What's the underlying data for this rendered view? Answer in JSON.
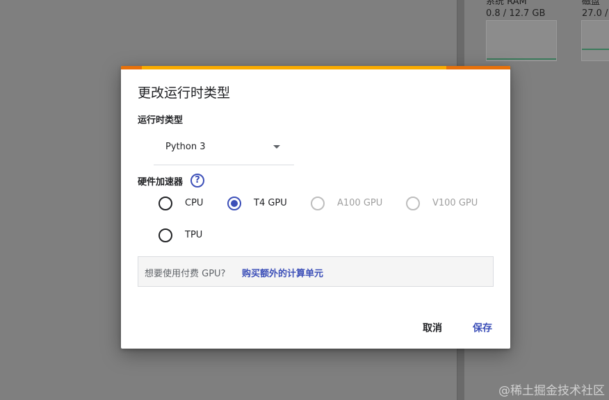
{
  "background": {
    "ram": {
      "label": "系统 RAM",
      "value": "0.8 / 12.7 GB"
    },
    "disk": {
      "label": "磁盘",
      "value": "27.0 /"
    }
  },
  "dialog": {
    "title": "更改运行时类型",
    "runtime_label": "运行时类型",
    "runtime_value": "Python 3",
    "accelerator_label": "硬件加速器",
    "help_glyph": "?",
    "options": [
      {
        "label": "CPU",
        "selected": false,
        "disabled": false
      },
      {
        "label": "T4 GPU",
        "selected": true,
        "disabled": false
      },
      {
        "label": "A100 GPU",
        "selected": false,
        "disabled": true
      },
      {
        "label": "V100 GPU",
        "selected": false,
        "disabled": true
      },
      {
        "label": "TPU",
        "selected": false,
        "disabled": false
      }
    ],
    "promo_question": "想要使用付费 GPU?",
    "promo_link": "购买额外的计算单元",
    "cancel_label": "取消",
    "save_label": "保存"
  },
  "watermark": "@稀土掘金技术社区",
  "colors": {
    "accent": "#3c4fb8",
    "strip_yellow": "#f9ab00",
    "strip_orange": "#e8710a",
    "overlay": "#7f7f7f"
  }
}
